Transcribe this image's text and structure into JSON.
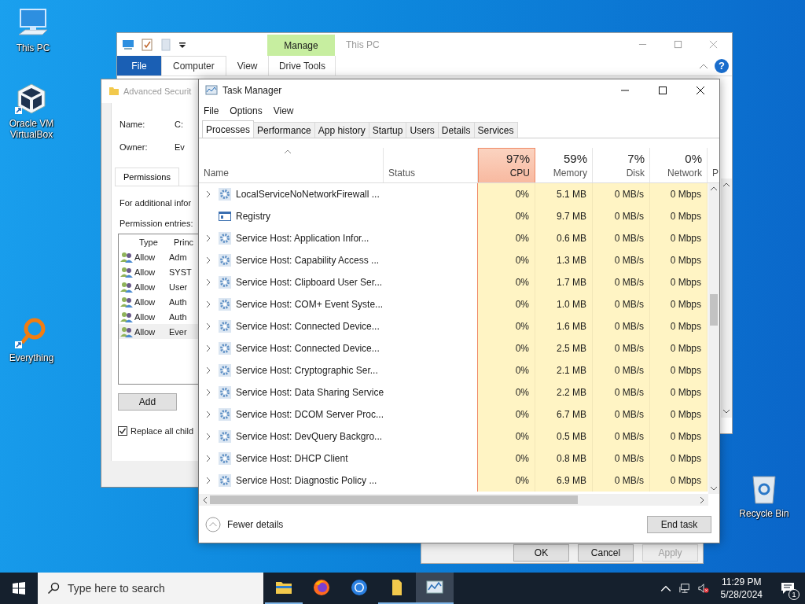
{
  "desktop_icons": [
    {
      "label": "This PC",
      "kind": "computer"
    },
    {
      "label": "Oracle VM VirtualBox",
      "kind": "cube"
    },
    {
      "label": "Everything",
      "kind": "magnifier"
    },
    {
      "label": "Recycle Bin",
      "kind": "bin"
    }
  ],
  "explorer": {
    "title": "This PC",
    "context_group": "Manage",
    "help": "?",
    "tabs": [
      {
        "label": "File",
        "kind": "file",
        "selected": false
      },
      {
        "label": "Computer",
        "kind": "tab",
        "selected": true
      },
      {
        "label": "View",
        "kind": "tab",
        "selected": false
      },
      {
        "label": "Drive Tools",
        "kind": "context",
        "selected": false
      }
    ]
  },
  "security_dialog": {
    "title": "Advanced Securit",
    "fields": [
      {
        "label": "Name:",
        "value": "C:"
      },
      {
        "label": "Owner:",
        "value": "Ev"
      }
    ],
    "tab": "Permissions",
    "info": "For additional infor",
    "entries_label": "Permission entries:",
    "columns": [
      "Type",
      "Princ"
    ],
    "entries": [
      {
        "type": "Allow",
        "principal": "Adm",
        "selected": false
      },
      {
        "type": "Allow",
        "principal": "SYST",
        "selected": false
      },
      {
        "type": "Allow",
        "principal": "User",
        "selected": false
      },
      {
        "type": "Allow",
        "principal": "Auth",
        "selected": false
      },
      {
        "type": "Allow",
        "principal": "Auth",
        "selected": false
      },
      {
        "type": "Allow",
        "principal": "Ever",
        "selected": true
      }
    ],
    "button": "Add",
    "replace_checkbox": {
      "label": "Replace all child",
      "checked": true
    }
  },
  "properties_dialog": {
    "buttons": [
      {
        "label": "OK",
        "disabled": false
      },
      {
        "label": "Cancel",
        "disabled": false
      },
      {
        "label": "Apply",
        "disabled": true
      }
    ]
  },
  "task_manager": {
    "title": "Task Manager",
    "menu": [
      "File",
      "Options",
      "View"
    ],
    "tabs": [
      {
        "label": "Processes",
        "selected": true
      },
      {
        "label": "Performance",
        "selected": false
      },
      {
        "label": "App history",
        "selected": false
      },
      {
        "label": "Startup",
        "selected": false
      },
      {
        "label": "Users",
        "selected": false
      },
      {
        "label": "Details",
        "selected": false
      },
      {
        "label": "Services",
        "selected": false
      }
    ],
    "columns": [
      {
        "kind": "name",
        "label": "Name"
      },
      {
        "kind": "status",
        "label": "Status"
      },
      {
        "kind": "metric",
        "reading": "97%",
        "label": "CPU",
        "alert": true
      },
      {
        "kind": "metric",
        "reading": "59%",
        "label": "Memory",
        "alert": false
      },
      {
        "kind": "metric",
        "reading": "7%",
        "label": "Disk",
        "alert": false
      },
      {
        "kind": "metric",
        "reading": "0%",
        "label": "Network",
        "alert": false
      },
      {
        "kind": "cut",
        "label": "P"
      }
    ],
    "rows": [
      {
        "name": "LocalServiceNoNetworkFirewall ...",
        "kind": "service",
        "expandable": true,
        "cpu": "0%",
        "memory": "5.1 MB",
        "disk": "0 MB/s",
        "network": "0 Mbps"
      },
      {
        "name": "Registry",
        "kind": "registry",
        "expandable": false,
        "cpu": "0%",
        "memory": "9.7 MB",
        "disk": "0 MB/s",
        "network": "0 Mbps"
      },
      {
        "name": "Service Host: Application Infor...",
        "kind": "service",
        "expandable": true,
        "cpu": "0%",
        "memory": "0.6 MB",
        "disk": "0 MB/s",
        "network": "0 Mbps"
      },
      {
        "name": "Service Host: Capability Access ...",
        "kind": "service",
        "expandable": true,
        "cpu": "0%",
        "memory": "1.3 MB",
        "disk": "0 MB/s",
        "network": "0 Mbps"
      },
      {
        "name": "Service Host: Clipboard User Ser...",
        "kind": "service",
        "expandable": true,
        "cpu": "0%",
        "memory": "1.7 MB",
        "disk": "0 MB/s",
        "network": "0 Mbps"
      },
      {
        "name": "Service Host: COM+ Event Syste...",
        "kind": "service",
        "expandable": true,
        "cpu": "0%",
        "memory": "1.0 MB",
        "disk": "0 MB/s",
        "network": "0 Mbps"
      },
      {
        "name": "Service Host: Connected Device...",
        "kind": "service",
        "expandable": true,
        "cpu": "0%",
        "memory": "1.6 MB",
        "disk": "0 MB/s",
        "network": "0 Mbps"
      },
      {
        "name": "Service Host: Connected Device...",
        "kind": "service",
        "expandable": true,
        "cpu": "0%",
        "memory": "2.5 MB",
        "disk": "0 MB/s",
        "network": "0 Mbps"
      },
      {
        "name": "Service Host: Cryptographic Ser...",
        "kind": "service",
        "expandable": true,
        "cpu": "0%",
        "memory": "2.1 MB",
        "disk": "0 MB/s",
        "network": "0 Mbps"
      },
      {
        "name": "Service Host: Data Sharing Service",
        "kind": "service",
        "expandable": true,
        "cpu": "0%",
        "memory": "2.2 MB",
        "disk": "0 MB/s",
        "network": "0 Mbps"
      },
      {
        "name": "Service Host: DCOM Server Proc...",
        "kind": "service",
        "expandable": true,
        "cpu": "0%",
        "memory": "6.7 MB",
        "disk": "0 MB/s",
        "network": "0 Mbps"
      },
      {
        "name": "Service Host: DevQuery Backgro...",
        "kind": "service",
        "expandable": true,
        "cpu": "0%",
        "memory": "0.5 MB",
        "disk": "0 MB/s",
        "network": "0 Mbps"
      },
      {
        "name": "Service Host: DHCP Client",
        "kind": "service",
        "expandable": true,
        "cpu": "0%",
        "memory": "0.8 MB",
        "disk": "0 MB/s",
        "network": "0 Mbps"
      },
      {
        "name": "Service Host: Diagnostic Policy ...",
        "kind": "service",
        "expandable": true,
        "cpu": "0%",
        "memory": "6.9 MB",
        "disk": "0 MB/s",
        "network": "0 Mbps"
      }
    ],
    "footer": {
      "toggle": "Fewer details",
      "button": "End task"
    }
  },
  "taskbar": {
    "search_placeholder": "Type here to search",
    "apps": [
      {
        "kind": "explorer",
        "running": true,
        "selected": false
      },
      {
        "kind": "firefox",
        "running": false,
        "selected": false
      },
      {
        "kind": "chrome",
        "running": false,
        "selected": false
      },
      {
        "kind": "folder",
        "running": true,
        "selected": false
      },
      {
        "kind": "taskmgr",
        "running": true,
        "selected": true
      }
    ],
    "time": "11:29 PM",
    "date": "5/28/2024",
    "notifications": "1"
  }
}
